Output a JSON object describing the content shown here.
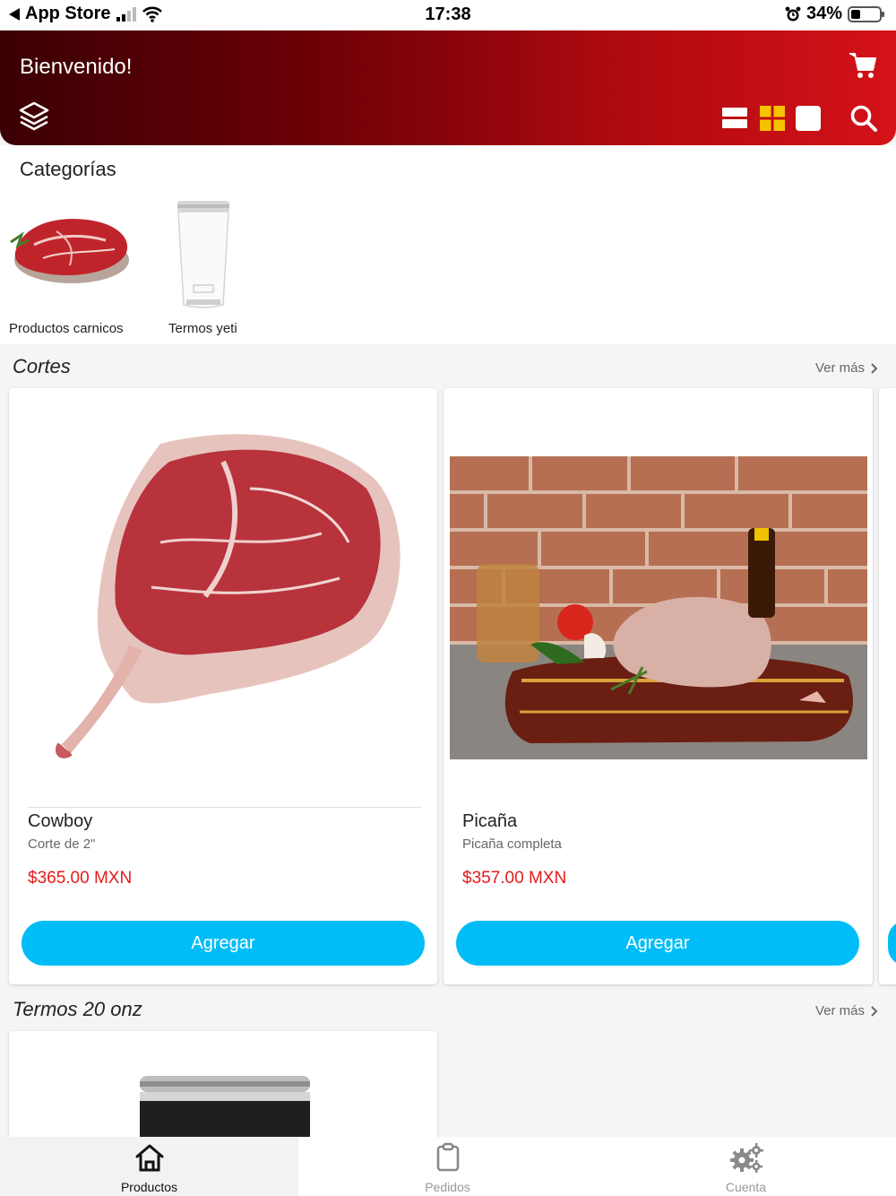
{
  "status_bar": {
    "back_app": "App Store",
    "time": "17:38",
    "battery": "34%"
  },
  "header": {
    "title": "Bienvenido!",
    "icons": [
      "layers-icon",
      "cart-icon",
      "list-view-icon",
      "grid-view-icon",
      "single-view-icon",
      "search-icon"
    ]
  },
  "categories": {
    "title": "Categorías",
    "items": [
      {
        "label": "Productos carnicos",
        "image": "raw-steak"
      },
      {
        "label": "Termos yeti",
        "image": "white-tumbler"
      }
    ]
  },
  "sections": [
    {
      "title": "Cortes",
      "see_more": "Ver más",
      "products": [
        {
          "name": "Cowboy",
          "description": "Corte de 2\"",
          "price": "$365.00 MXN",
          "button": "Agregar",
          "image": "cowboy-ribeye"
        },
        {
          "name": "Picaña",
          "description": "Picaña completa",
          "price": "$357.00 MXN",
          "button": "Agregar",
          "image": "picanha-on-board"
        }
      ]
    },
    {
      "title": "Termos 20 onz",
      "see_more": "Ver más",
      "products": [
        {
          "image": "black-tumbler"
        }
      ]
    }
  ],
  "tabbar": {
    "tabs": [
      {
        "label": "Productos",
        "icon": "home-icon",
        "active": true
      },
      {
        "label": "Pedidos",
        "icon": "clipboard-icon",
        "active": false
      },
      {
        "label": "Cuenta",
        "icon": "gears-icon",
        "active": false
      }
    ]
  },
  "colors": {
    "header_dark": "#3a0004",
    "header_bright": "#d41218",
    "accent_blue": "#00bdf7",
    "price_red": "#e41a1a",
    "grid_icon_yellow": "#f5c400"
  }
}
